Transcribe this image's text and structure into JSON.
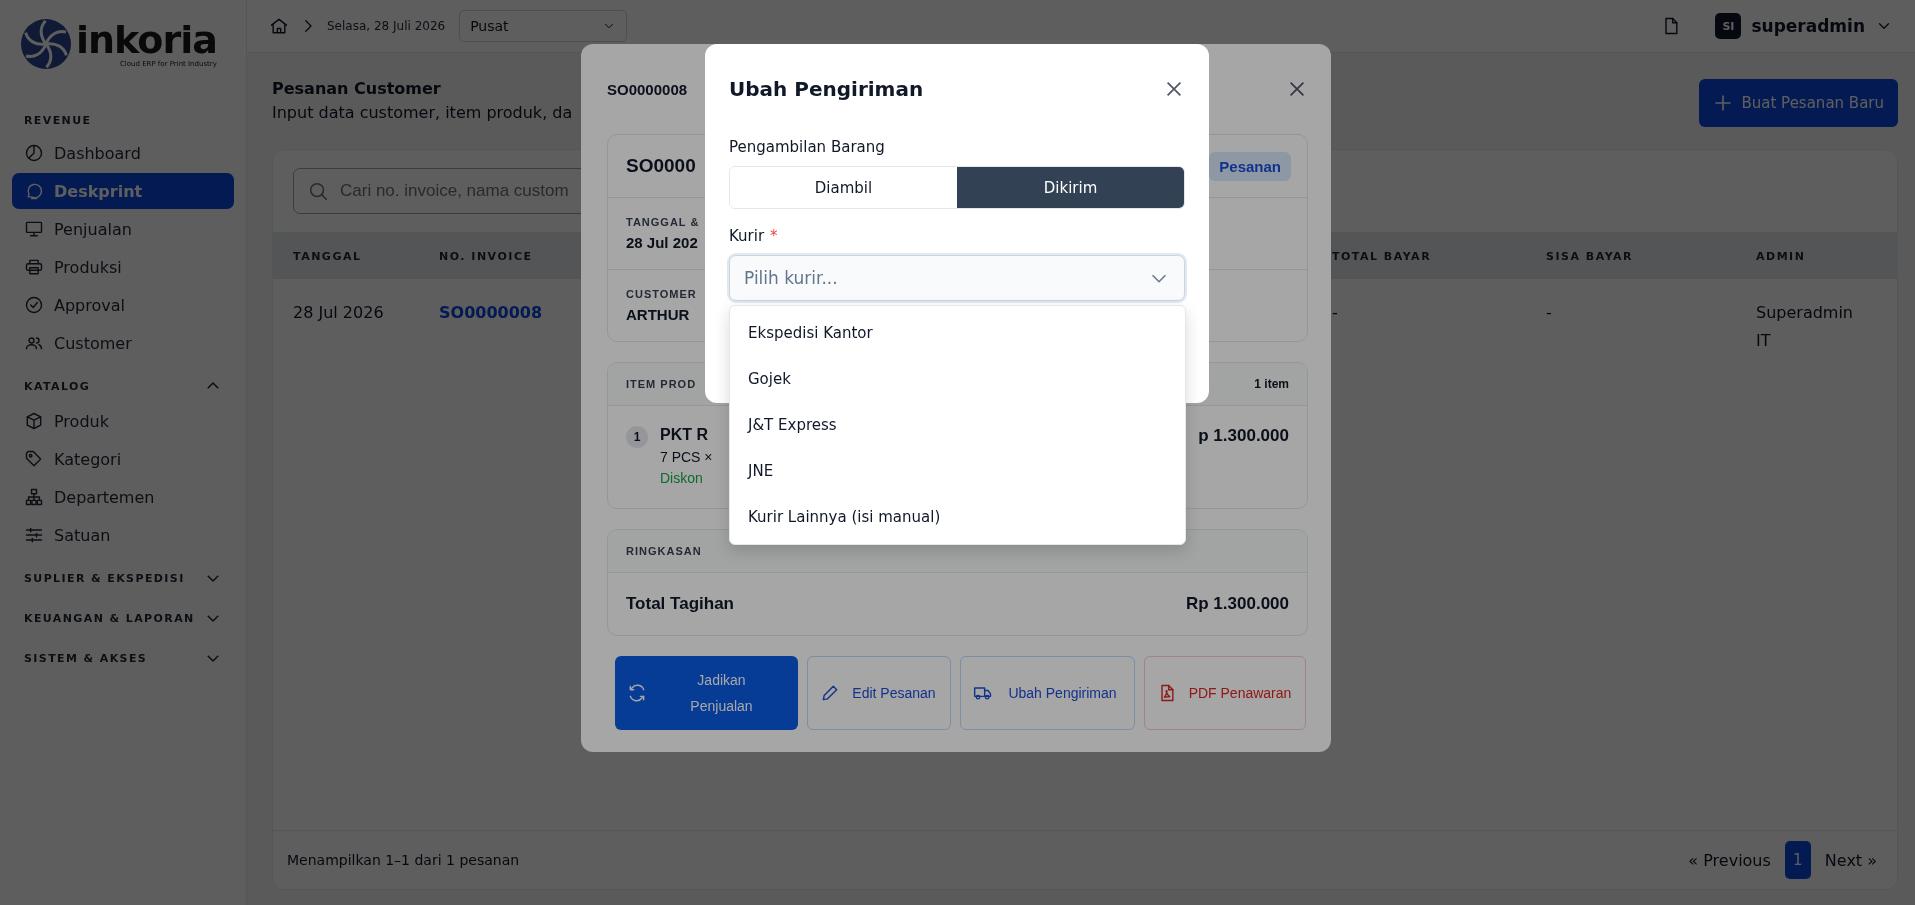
{
  "sidebar": {
    "logo": {
      "name": "inkoria",
      "tagline": "Cloud ERP for Print Industry"
    },
    "sections": [
      {
        "title": "REVENUE",
        "items": [
          {
            "label": "Dashboard",
            "selected": false
          },
          {
            "label": "Deskprint",
            "selected": true
          },
          {
            "label": "Penjualan",
            "selected": false
          },
          {
            "label": "Produksi",
            "selected": false
          },
          {
            "label": "Approval",
            "selected": false
          },
          {
            "label": "Customer",
            "selected": false
          }
        ]
      },
      {
        "title": "KATALOG",
        "expanded": true,
        "items": [
          {
            "label": "Produk",
            "selected": false
          },
          {
            "label": "Kategori",
            "selected": false
          },
          {
            "label": "Departemen",
            "selected": false
          },
          {
            "label": "Satuan",
            "selected": false
          }
        ]
      },
      {
        "title": "SUPLIER & EKSPEDISI",
        "expanded": false
      },
      {
        "title": "KEUANGAN & LAPORAN",
        "expanded": false
      },
      {
        "title": "SISTEM & AKSES",
        "expanded": false
      }
    ]
  },
  "topbar": {
    "date": "Selasa, 28 Juli 2026",
    "branch": "Pusat",
    "user_initials": "SI",
    "username": "superadmin"
  },
  "page": {
    "title": "Pesanan Customer",
    "subtitle": "Input data customer, item produk, da",
    "new_button": "Buat Pesanan Baru"
  },
  "table": {
    "search": {
      "placeholder": "Cari no. invoice, nama custom"
    },
    "columns": [
      "TANGGAL",
      "NO. INVOICE",
      "TOTAL BAYAR",
      "SISA BAYAR",
      "ADMIN"
    ],
    "rows": [
      {
        "cells": [
          "28 Jul 2026",
          "SO0000008",
          "-",
          "-",
          "Superadmin IT"
        ]
      }
    ]
  },
  "pagination": {
    "summary": "Menampilkan 1–1 dari 1 pesanan",
    "previous": "« Previous",
    "next": "Next »",
    "pages": [
      {
        "label": "1",
        "selected": true
      }
    ]
  },
  "detail_modal": {
    "title": "SO0000008",
    "header_number": "SO0000",
    "status_badge": "Pesanan",
    "date_label": "TANGGAL &",
    "date_value": "28 Jul 202",
    "customer_label": "CUSTOMER",
    "customer_value": "ARTHUR",
    "items_label": "ITEM PROD",
    "items_count": "1 item",
    "items": [
      {
        "number": "1",
        "name": "PKT R",
        "qty": "7 PCS ×",
        "discount": "Diskon",
        "price": "p 1.300.000"
      }
    ],
    "summary_label": "RINGKASAN",
    "total_label": "Total Tagihan",
    "total_value": "Rp 1.300.000",
    "actions": [
      {
        "kind": "primary",
        "label": "Jadikan Penjualan"
      },
      {
        "kind": "outline",
        "label": "Edit Pesanan"
      },
      {
        "kind": "outline",
        "label": "Ubah Pengiriman"
      },
      {
        "kind": "danger",
        "label": "PDF Penawaran"
      }
    ]
  },
  "shipping_modal": {
    "title": "Ubah Pengiriman",
    "pickup_label": "Pengambilan Barang",
    "pickup_options": [
      {
        "label": "Diambil",
        "selected": false
      },
      {
        "label": "Dikirim",
        "selected": true
      }
    ],
    "courier_label": "Kurir",
    "required_mark": "*",
    "courier_select": {
      "placeholder": "Pilih kurir...",
      "expanded": true,
      "options": [
        "Ekspedisi Kantor",
        "Gojek",
        "J&T Express",
        "JNE",
        "Kurir Lainnya (isi manual)"
      ]
    }
  }
}
